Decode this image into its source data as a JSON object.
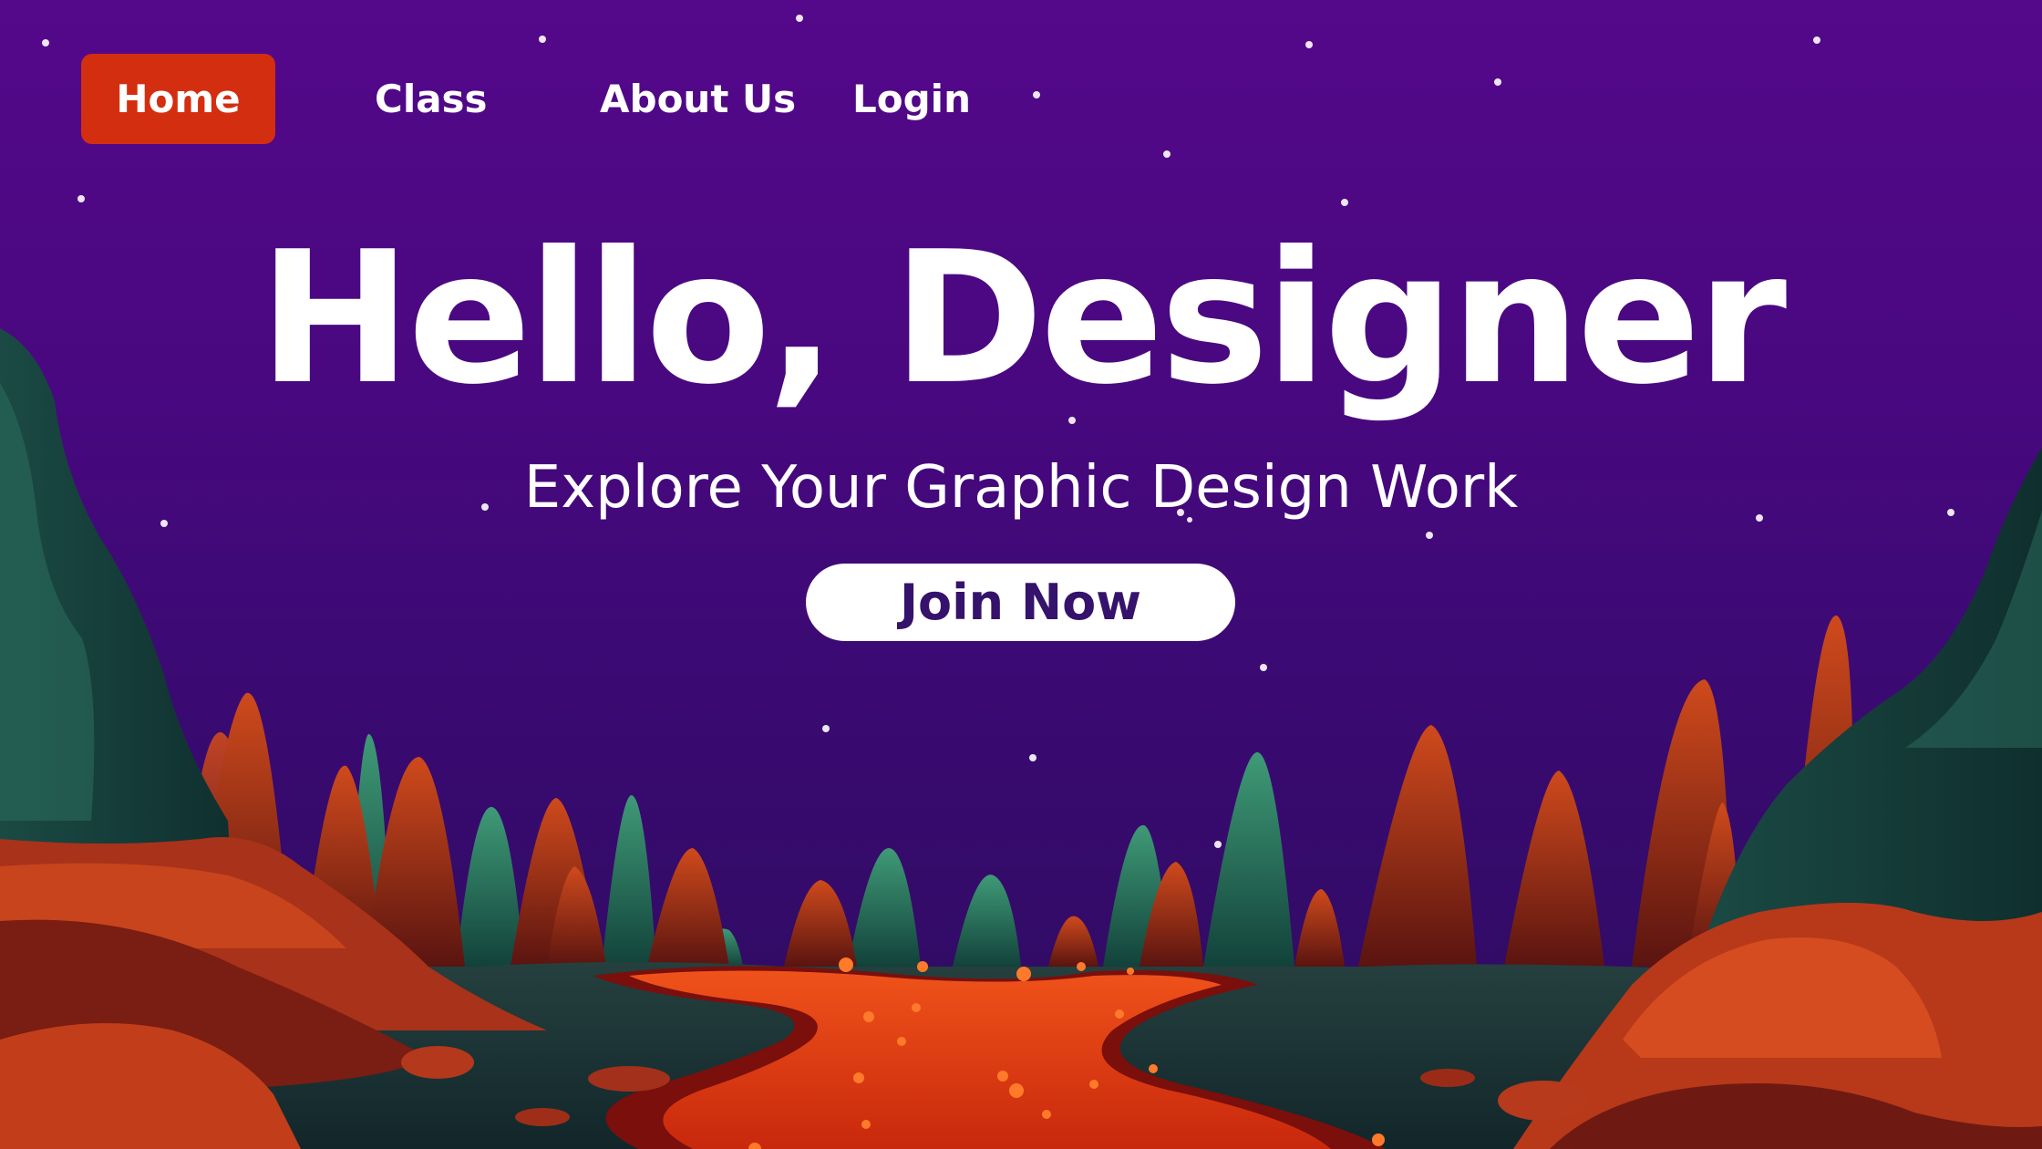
{
  "nav": {
    "home_label": "Home",
    "class_label": "Class",
    "about_label": "About Us",
    "login_label": "Login"
  },
  "hero": {
    "title": "Hello, Designer",
    "subtitle": "Explore Your Graphic Design Work",
    "cta_label": "Join Now"
  },
  "colors": {
    "sky_top": "#54088a",
    "sky_bottom": "#2d0c5f",
    "home_button": "#d42e10",
    "cta_background": "#ffffff",
    "cta_text": "#35126b",
    "rock_orange": "#b8371a",
    "rock_green": "#1e5f52",
    "lava": "#e8420f"
  }
}
